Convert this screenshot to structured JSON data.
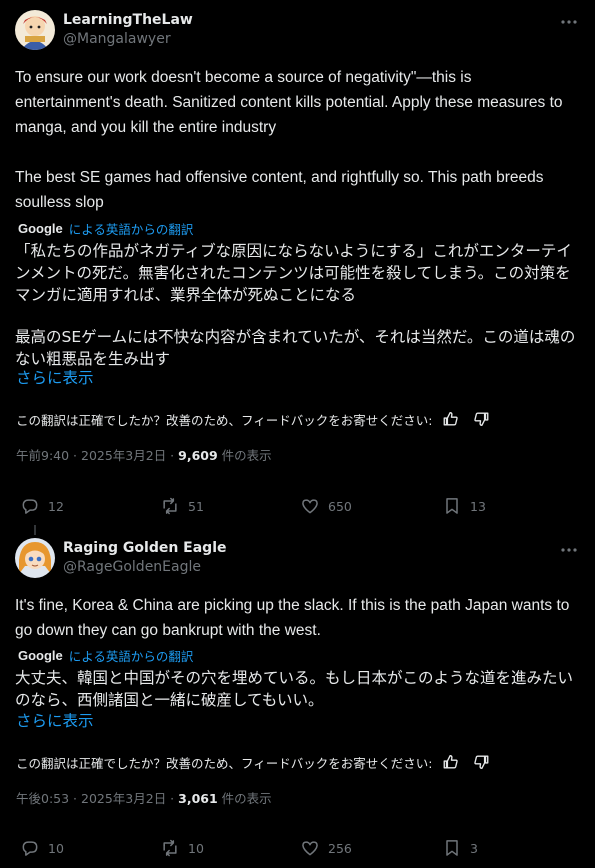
{
  "tweets": [
    {
      "display_name": "LearningTheLaw",
      "handle": "@Mangalawyer",
      "more_icon": "more-dots-icon",
      "text_en": [
        "To ensure our work doesn't become a source of negativity\"—this is entertainment's death. Sanitized content kills potential. Apply these measures to manga, and you kill the entire industry",
        "The best SE games had offensive content, and rightfully so. This path breeds soulless slop"
      ],
      "google_label": "Google",
      "translate_label": "による英語からの翻訳",
      "text_ja": [
        "「私たちの作品がネガティブな原因にならないようにする」これがエンターテインメントの死だ。無害化されたコンテンツは可能性を殺してしまう。この対策をマンガに適用すれば、業界全体が死ぬことになる",
        "最高のSEゲームには不快な内容が含まれていたが、それは当然だ。この道は魂のない粗悪品を生み出す"
      ],
      "show_more": "さらに表示",
      "feedback_text": "この翻訳は正確でしたか？改善のため、フィードバックをお寄せください:",
      "timestamp": "午前9:40 · 2025年3月2日 · ",
      "views_count": "9,609",
      "views_label": " 件の表示",
      "replies": "12",
      "reposts": "51",
      "likes": "650",
      "bookmarks": "13"
    },
    {
      "display_name": "Raging Golden Eagle",
      "handle": "@RageGoldenEagle",
      "more_icon": "more-dots-icon",
      "text_en": [
        "It's fine, Korea & China are picking up the slack.  If this is the path Japan wants to go down they can go bankrupt with the west."
      ],
      "google_label": "Google",
      "translate_label": "による英語からの翻訳",
      "text_ja": [
        "大丈夫、韓国と中国がその穴を埋めている。もし日本がこのような道を進みたいのなら、西側諸国と一緒に破産してもいい。"
      ],
      "show_more": "さらに表示",
      "feedback_text": "この翻訳は正確でしたか？改善のため、フィードバックをお寄せください:",
      "timestamp": "午後0:53 · 2025年3月2日 · ",
      "views_count": "3,061",
      "views_label": " 件の表示",
      "replies": "10",
      "reposts": "10",
      "likes": "256",
      "bookmarks": "3"
    }
  ],
  "colors": {
    "background": "#000000",
    "text": "#e7e9ea",
    "muted": "#71767b",
    "link": "#1d9bf0",
    "divider": "#333639"
  }
}
